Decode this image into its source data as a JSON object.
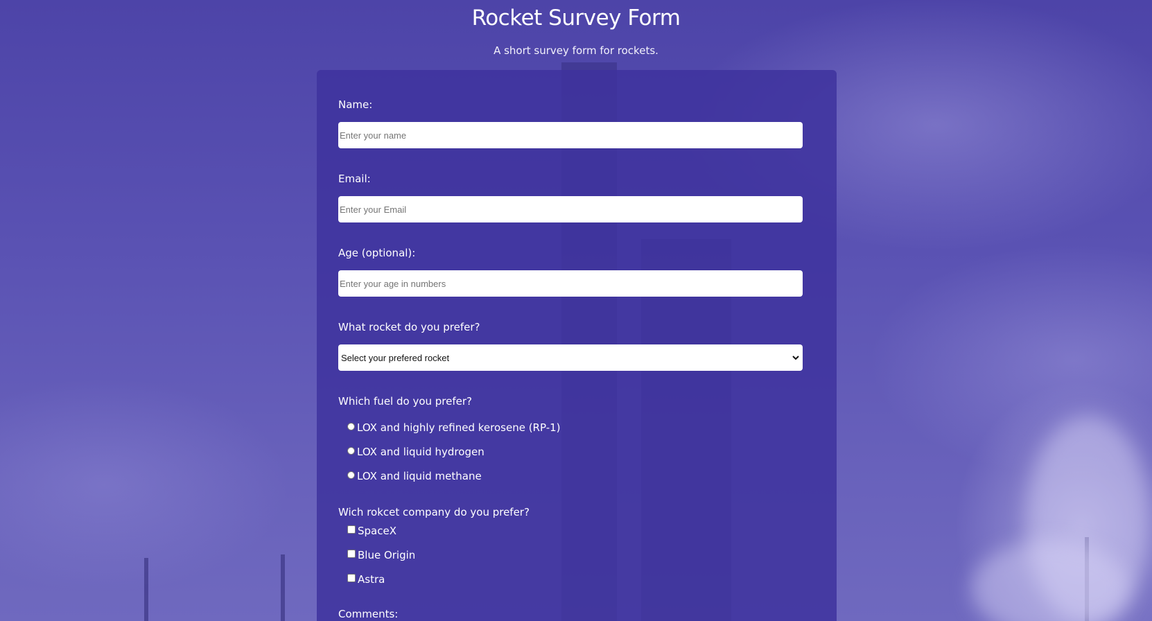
{
  "header": {
    "title": "Rocket Survey Form",
    "description": "A short survey form for rockets."
  },
  "form": {
    "name": {
      "label": "Name:",
      "placeholder": "Enter your name",
      "value": ""
    },
    "email": {
      "label": "Email:",
      "placeholder": "Enter your Email",
      "value": ""
    },
    "age": {
      "label": "Age (optional):",
      "placeholder": "Enter your age in numbers",
      "value": ""
    },
    "rocket": {
      "label": "What rocket do you prefer?",
      "selected": "Select your prefered rocket"
    },
    "fuel": {
      "label": "Which fuel do you prefer?",
      "options": [
        "LOX and highly refined kerosene (RP-1)",
        "LOX and liquid hydrogen",
        "LOX and liquid methane"
      ]
    },
    "company": {
      "label": "Wich rokcet company do you prefer?",
      "options": [
        "SpaceX",
        "Blue Origin",
        "Astra"
      ]
    },
    "comments": {
      "label": "Comments:"
    }
  },
  "colors": {
    "card_background": "#3e329e",
    "page_background": "#5e55b0",
    "text": "#ffffff"
  }
}
